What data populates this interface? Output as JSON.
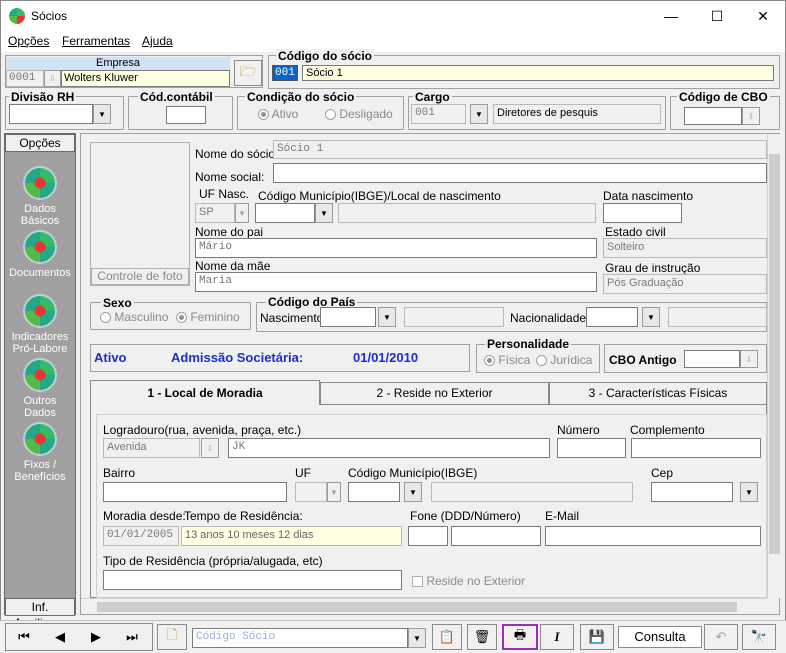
{
  "window": {
    "title": "Sócios",
    "minimize": "—",
    "maximize": "☐",
    "close": "✕"
  },
  "menu": [
    "Opções",
    "Ferramentas",
    "Ajuda"
  ],
  "empresa": {
    "label": "Empresa",
    "code": "0001",
    "name": "Wolters Kluwer"
  },
  "socio": {
    "title": "Código do sócio",
    "code": "001",
    "name": "Sócio 1"
  },
  "divisao": {
    "title": "Divisão RH"
  },
  "contabil": {
    "title": "Cód.contábil"
  },
  "condicao": {
    "title": "Condição do sócio",
    "ativo": "Ativo",
    "desligado": "Desligado"
  },
  "cargo": {
    "title": "Cargo",
    "code": "001",
    "name": "Diretores de pesquis"
  },
  "cbo": {
    "title": "Código de CBO"
  },
  "sidebar": {
    "header": "Opções",
    "items": [
      "Dados Básicos",
      "Documentos",
      "Indicadores Pró-Labore",
      "Outros Dados",
      "Fixos / Benefícios"
    ],
    "footer": "Inf. Auxiliares"
  },
  "form": {
    "foto_button": "Controle de foto",
    "nome_socio_label": "Nome do sócio:",
    "nome_socio": "Sócio 1",
    "nome_social_label": "Nome social:",
    "uf_nasc_label": "UF Nasc.",
    "uf_nasc": "SP",
    "municipio_label": "Código Município(IBGE)/Local de nascimento",
    "data_nasc_label": "Data nascimento",
    "pai_label": "Nome do pai",
    "pai": "Mário",
    "estado_civil_label": "Estado civil",
    "estado_civil": "Solteiro",
    "mae_label": "Nome da mãe",
    "mae": "Maria",
    "grau_label": "Grau de instrução",
    "grau": "Pós Graduação",
    "sexo_title": "Sexo",
    "masculino": "Masculino",
    "feminino": "Feminino",
    "pais_title": "Código do País",
    "nascimento_label": "Nascimento",
    "nacionalidade_label": "Nacionalidade",
    "status": "Ativo",
    "admissao_label": "Admissão Societária:",
    "admissao": "01/01/2010",
    "personalidade_title": "Personalidade",
    "fisica": "Física",
    "juridica": "Jurídica",
    "cbo_antigo_label": "CBO Antigo"
  },
  "tabs": [
    "1 - Local de Moradia",
    "2 - Reside no Exterior",
    "3 - Características Físicas"
  ],
  "moradia": {
    "logradouro_label": "Logradouro(rua, avenida, praça, etc.)",
    "logradouro_tipo": "Avenida",
    "logradouro": "JK",
    "numero_label": "Número",
    "complemento_label": "Complemento",
    "bairro_label": "Bairro",
    "uf_label": "UF",
    "municipio_label": "Código Município(IBGE)",
    "cep_label": "Cep",
    "desde_label": "Moradia desde:",
    "desde": "01/01/2005",
    "tempo_label": "Tempo de Residência:",
    "tempo": "13 anos 10 meses 12 dias",
    "fone_label": "Fone (DDD/Número)",
    "email_label": "E-Mail",
    "tipo_label": "Tipo de Residência  (própria/alugada, etc)",
    "exterior_label": "Reside no Exterior"
  },
  "toolbar": {
    "search_placeholder": "Código Sócio",
    "consulta": "Consulta"
  }
}
